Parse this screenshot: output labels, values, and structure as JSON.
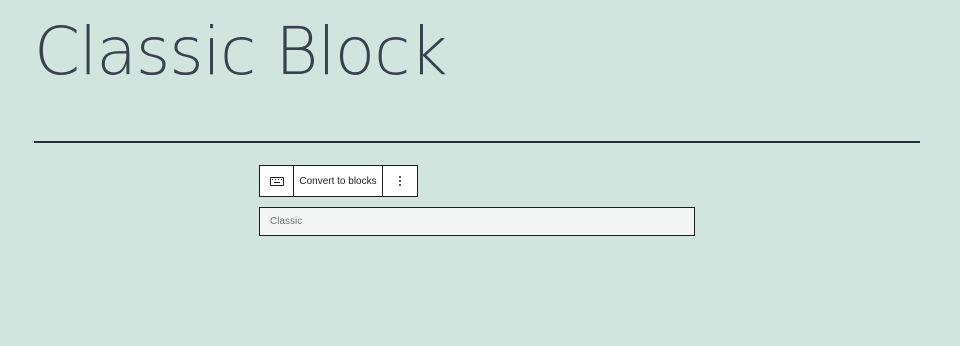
{
  "page": {
    "title": "Classic Block"
  },
  "toolbar": {
    "keyboard_icon": "keyboard-icon",
    "convert_label": "Convert to blocks",
    "more_icon": "more-vertical-icon"
  },
  "editor": {
    "label": "Classic"
  },
  "colors": {
    "background": "#d1e4dd",
    "text": "#28303d",
    "border": "#1e1e1e"
  }
}
